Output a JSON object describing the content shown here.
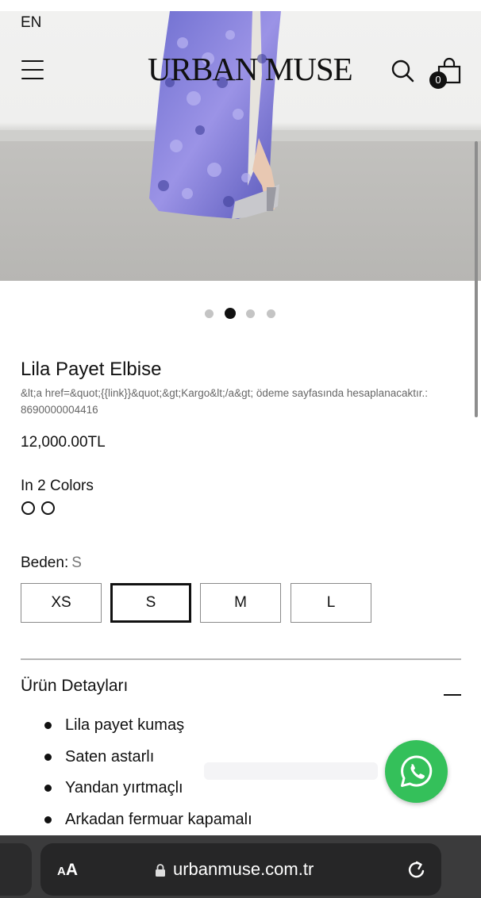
{
  "header": {
    "language": "EN",
    "logo": "URBAN MUSE",
    "cart_count": "0",
    "icons": [
      "menu-icon",
      "search-icon",
      "shopping-bag-icon"
    ]
  },
  "gallery": {
    "image_alt": "product-photo-sequin-dress",
    "slide_count": 4,
    "active_slide": 2
  },
  "product": {
    "title": "Lila Payet Elbise",
    "subtitle": "&lt;a href=&quot;{{link}}&quot;&gt;Kargo&lt;/a&gt; ödeme sayfasında hesaplanacaktır.: 8690000004416",
    "price": "12,000.00TL",
    "colors_label": "In 2 Colors",
    "size_label": "Beden:",
    "size_selected": "S",
    "sizes": [
      "XS",
      "S",
      "M",
      "L"
    ]
  },
  "details": {
    "title": "Ürün Detayları",
    "items": [
      "Lila payet kumaş",
      "Saten astarlı",
      "Yandan yırtmaçlı",
      "Arkadan fermuar kapamalı"
    ]
  },
  "whatsapp": {
    "icon": "whatsapp-icon",
    "color": "#34c05a"
  },
  "browser": {
    "text_size_label_small": "A",
    "text_size_label_large": "A",
    "url": "urbanmuse.com.tr",
    "icons": [
      "lock-icon",
      "reload-icon"
    ]
  }
}
